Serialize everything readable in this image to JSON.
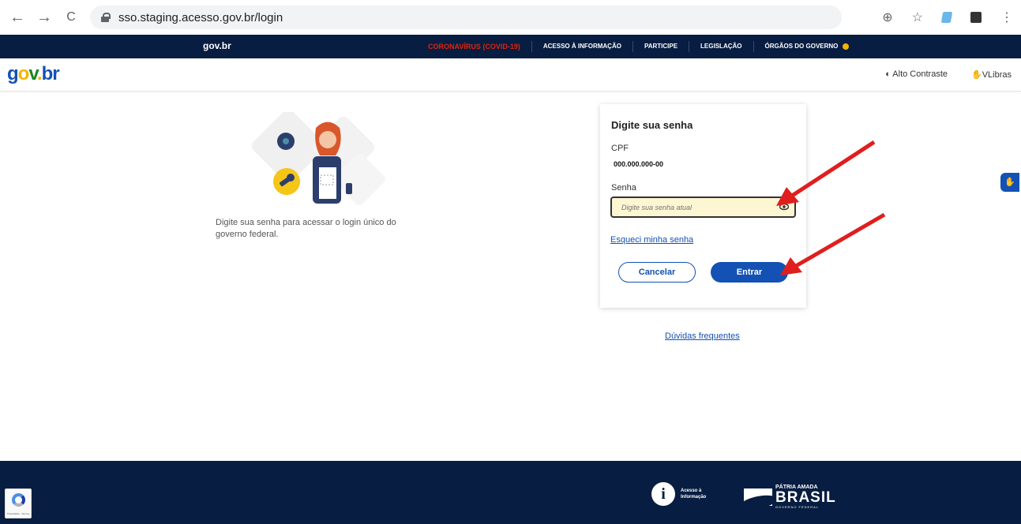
{
  "browser": {
    "url": "sso.staging.acesso.gov.br/login",
    "back_glyph": "←",
    "forward_glyph": "→",
    "reload_glyph": "C",
    "zoom_glyph": "⊕",
    "star_glyph": "☆",
    "menu_glyph": "⋮"
  },
  "topbar": {
    "brand": "gov.br",
    "links": [
      "CORONAVÍRUS (COVID-19)",
      "ACESSO À INFORMAÇÃO",
      "PARTICIPE",
      "LEGISLAÇÃO",
      "ÓRGÃOS DO GOVERNO"
    ]
  },
  "header": {
    "logo": {
      "g": "g",
      "o": "o",
      "v": "v",
      "dot": ".",
      "br": "br"
    },
    "alto_contraste": "◐ Alto Contraste",
    "vlibras": "✋VLibras"
  },
  "left": {
    "description": "Digite sua senha para acessar o login único do governo federal."
  },
  "card": {
    "title": "Digite sua senha",
    "cpf_label": "CPF",
    "cpf_value": "000.000.000-00",
    "senha_label": "Senha",
    "senha_placeholder": "Digite sua senha atual",
    "forgot": "Esqueci minha senha",
    "cancel": "Cancelar",
    "enter": "Entrar"
  },
  "faq": "Dúvidas frequentes",
  "footer": {
    "info_glyph": "i",
    "info_line1": "Acesso à",
    "info_line2": "Informação",
    "patria": "PÁTRIA AMADA",
    "brasil": "BRASIL",
    "gov_federal": "GOVERNO FEDERAL"
  },
  "recaptcha": {
    "terms": "Privacidade - Termos"
  },
  "colors": {
    "primary": "#1351b4",
    "dark_blue": "#071d41",
    "covid_red": "#e52207",
    "arrow_red": "#e01e1e",
    "input_bg": "#fcf6d2"
  }
}
